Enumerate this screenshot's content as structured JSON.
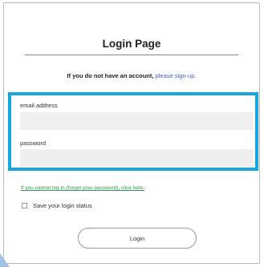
{
  "page": {
    "title": "Login Page",
    "signup_prefix": "If you do not have an account,",
    "signup_link": "please sign-up."
  },
  "form": {
    "email_label": "email address",
    "email_value": "",
    "password_label": "password",
    "password_value": "",
    "forgot_link": "If you cannot log in (forgot your password), click here.",
    "remember_label": "Save your login status",
    "remember_checked": false,
    "login_button": "Login"
  },
  "colors": {
    "highlight": "#17a5e0",
    "signup_link": "#3a5fcd",
    "forgot_link": "#2f9a4c",
    "input_bg": "#efefef"
  }
}
